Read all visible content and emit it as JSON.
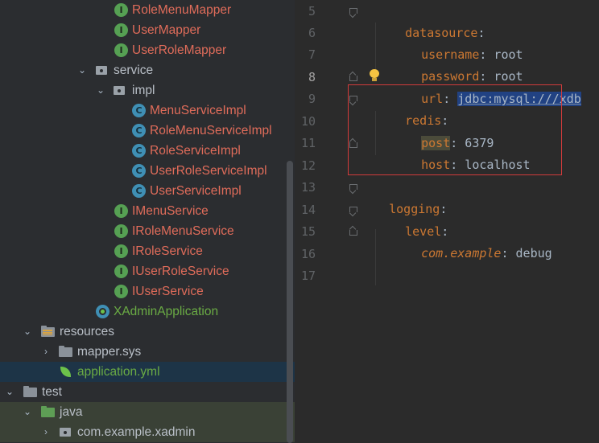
{
  "tree": {
    "rows": [
      {
        "label": "RoleMenuMapper",
        "kind": "interface",
        "color": "red"
      },
      {
        "label": "UserMapper",
        "kind": "interface",
        "color": "red"
      },
      {
        "label": "UserRoleMapper",
        "kind": "interface",
        "color": "red"
      },
      {
        "label": "service",
        "kind": "package",
        "color": "plain"
      },
      {
        "label": "impl",
        "kind": "package",
        "color": "plain"
      },
      {
        "label": "MenuServiceImpl",
        "kind": "class",
        "color": "red"
      },
      {
        "label": "RoleMenuServiceImpl",
        "kind": "class",
        "color": "red"
      },
      {
        "label": "RoleServiceImpl",
        "kind": "class",
        "color": "red"
      },
      {
        "label": "UserRoleServiceImpl",
        "kind": "class",
        "color": "red"
      },
      {
        "label": "UserServiceImpl",
        "kind": "class",
        "color": "red"
      },
      {
        "label": "IMenuService",
        "kind": "interface",
        "color": "red"
      },
      {
        "label": "IRoleMenuService",
        "kind": "interface",
        "color": "red"
      },
      {
        "label": "IRoleService",
        "kind": "interface",
        "color": "red"
      },
      {
        "label": "IUserRoleService",
        "kind": "interface",
        "color": "red"
      },
      {
        "label": "IUserService",
        "kind": "interface",
        "color": "red"
      },
      {
        "label": "XAdminApplication",
        "kind": "spring-app",
        "color": "green"
      },
      {
        "label": "resources",
        "kind": "resources-folder",
        "color": "plain"
      },
      {
        "label": "mapper.sys",
        "kind": "folder",
        "color": "plain"
      },
      {
        "label": "application.yml",
        "kind": "spring-config",
        "color": "green"
      },
      {
        "label": "test",
        "kind": "folder",
        "color": "plain"
      },
      {
        "label": "java",
        "kind": "test-folder",
        "color": "plain"
      },
      {
        "label": "com.example.xadmin",
        "kind": "package",
        "color": "plain"
      }
    ],
    "selected": "application.yml"
  },
  "editor": {
    "line_numbers": [
      "5",
      "6",
      "7",
      "8",
      "9",
      "10",
      "11",
      "12",
      "13",
      "14",
      "15",
      "16",
      "17"
    ],
    "current_line": "8",
    "lines": [
      {
        "key": "datasource",
        "sep": ":",
        "value": ""
      },
      {
        "key": "username",
        "sep": ":",
        "value": " root"
      },
      {
        "key": "password",
        "sep": ":",
        "value": " root"
      },
      {
        "key": "url",
        "sep": ":",
        "value": "jdbc:mysql:///xdb"
      },
      {
        "key": "redis",
        "sep": ":",
        "value": ""
      },
      {
        "key": "post",
        "sep": ":",
        "value": " 6379"
      },
      {
        "key": "host",
        "sep": ":",
        "value": " localhost"
      },
      {
        "key": "",
        "sep": "",
        "value": ""
      },
      {
        "key": "logging",
        "sep": ":",
        "value": ""
      },
      {
        "key": "level",
        "sep": ":",
        "value": ""
      },
      {
        "key": "com.example",
        "sep": ":",
        "value": " debug"
      },
      {
        "key": "",
        "sep": "",
        "value": ""
      },
      {
        "key": "",
        "sep": "",
        "value": ""
      }
    ]
  },
  "colors": {
    "key": "#cc7832",
    "value": "#a9b7c6",
    "tree_red": "#e06c5a",
    "tree_green": "#6aab44",
    "selection": "#1d3447",
    "annotation_box": "#d23b3b"
  },
  "icons": [
    "interface-icon",
    "class-icon",
    "package-icon",
    "folder-icon",
    "resources-folder-icon",
    "spring-app-icon",
    "spring-config-icon",
    "chevron-right-icon",
    "chevron-down-icon",
    "lightbulb-icon",
    "fold-icon"
  ]
}
